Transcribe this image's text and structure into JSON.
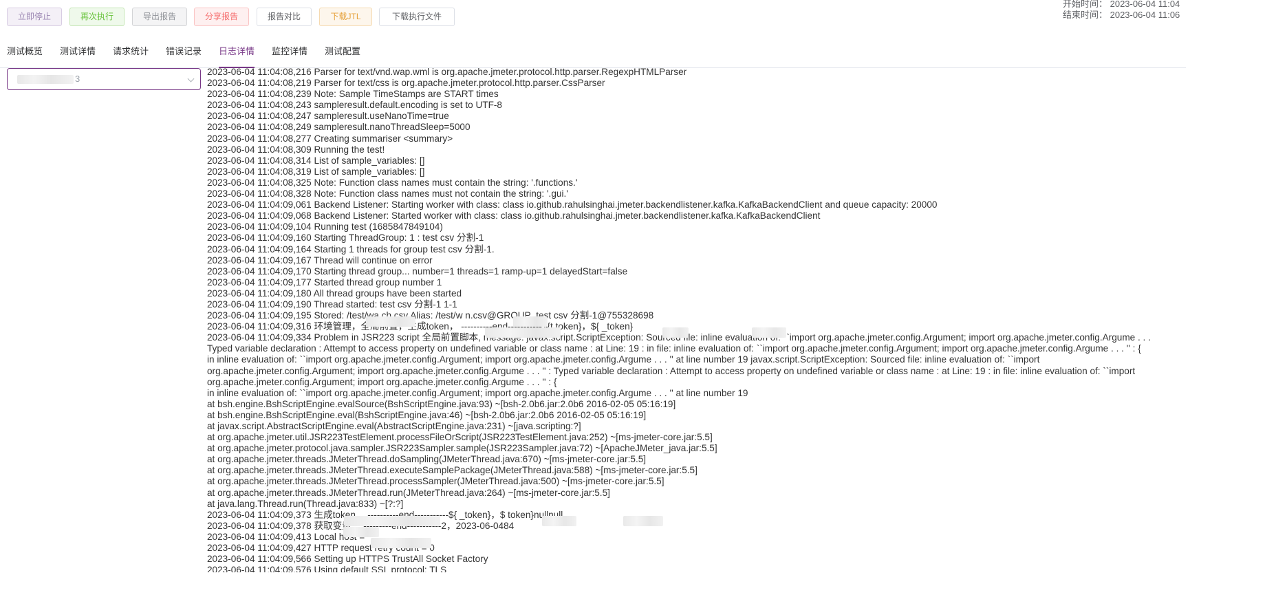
{
  "toolbar": {
    "stop": "立即停止",
    "rerun": "再次执行",
    "export": "导出报告",
    "share": "分享报告",
    "compare": "报告对比",
    "jtl": "下载JTL",
    "exec_file": "下载执行文件"
  },
  "times": {
    "start": "开始时间： 2023-06-04 11:04",
    "end": "结束时间： 2023-06-04 11:06"
  },
  "tabs": [
    "测试概览",
    "测试详情",
    "请求统计",
    "错误记录",
    "日志详情",
    "监控详情",
    "测试配置"
  ],
  "active_tab": "日志详情",
  "selector": {
    "value": "3"
  },
  "log_lines": [
    "2023-06-04 11:04:08,216 Parser for text/vnd.wap.wml is org.apache.jmeter.protocol.http.parser.RegexpHTMLParser",
    "2023-06-04 11:04:08,219 Parser for text/css is org.apache.jmeter.protocol.http.parser.CssParser",
    "2023-06-04 11:04:08,239 Note: Sample TimeStamps are START times",
    "2023-06-04 11:04:08,243 sampleresult.default.encoding is set to UTF-8",
    "2023-06-04 11:04:08,247 sampleresult.useNanoTime=true",
    "2023-06-04 11:04:08,249 sampleresult.nanoThreadSleep=5000",
    "2023-06-04 11:04:08,277 Creating summariser <summary>",
    "2023-06-04 11:04:08,309 Running the test!",
    "2023-06-04 11:04:08,314 List of sample_variables: []",
    "2023-06-04 11:04:08,319 List of sample_variables: []",
    "2023-06-04 11:04:08,325 Note: Function class names must contain the string: '.functions.'",
    "2023-06-04 11:04:08,328 Note: Function class names must not contain the string: '.gui.'",
    "2023-06-04 11:04:09,061 Backend Listener: Starting worker with class: class io.github.rahulsinghai.jmeter.backendlistener.kafka.KafkaBackendClient and queue capacity: 20000",
    "2023-06-04 11:04:09,068 Backend Listener: Started worker with class: class io.github.rahulsinghai.jmeter.backendlistener.kafka.KafkaBackendClient",
    "2023-06-04 11:04:09,104 Running test (1685847849104)",
    "2023-06-04 11:04:09,160 Starting ThreadGroup: 1 : test csv 分割-1",
    "2023-06-04 11:04:09,164 Starting 1 threads for group test csv 分割-1.",
    "2023-06-04 11:04:09,167 Thread will continue on error",
    "2023-06-04 11:04:09,170 Starting thread group... number=1 threads=1 ramp-up=1 delayedStart=false",
    "2023-06-04 11:04:09,177 Started thread group number 1",
    "2023-06-04 11:04:09,180 All thread groups have been started",
    "2023-06-04 11:04:09,190 Thread started: test csv 分割-1 1-1",
    "2023-06-04 11:04:09,195 Stored: /test/wa                ch.csv Alias: /test/w              n.csv@GROUP_test csv 分割-1@755328698",
    "2023-06-04 11:04:09,316 环境管理，全局前置，生成token，        ----------end-----------${t          token}，${              _token}",
    "2023-06-04 11:04:09,334 Problem in JSR223 script 全局前置脚本, message: javax.script.ScriptException: Sourced file: inline evaluation of: ``import org.apache.jmeter.config.Argument; import org.apache.jmeter.config.Argume . . .",
    "Typed variable declaration : Attempt to access property on undefined variable or class name : at Line: 19 : in file: inline evaluation of: ``import org.apache.jmeter.config.Argument; import org.apache.jmeter.config.Argume . . . '' : {",
    "in inline evaluation of: ``import org.apache.jmeter.config.Argument; import org.apache.jmeter.config.Argume . . . '' at line number 19 javax.script.ScriptException: Sourced file: inline evaluation of: ``import",
    "org.apache.jmeter.config.Argument; import org.apache.jmeter.config.Argume . . . '' : Typed variable declaration : Attempt to access property on undefined variable or class name : at Line: 19 : in file: inline evaluation of: ``import",
    "org.apache.jmeter.config.Argument; import org.apache.jmeter.config.Argume . . . '' : {",
    "in inline evaluation of: ``import org.apache.jmeter.config.Argument; import org.apache.jmeter.config.Argume . . . '' at line number 19",
    "at bsh.engine.BshScriptEngine.evalSource(BshScriptEngine.java:93) ~[bsh-2.0b6.jar:2.0b6 2016-02-05 05:16:19]",
    "at bsh.engine.BshScriptEngine.eval(BshScriptEngine.java:46) ~[bsh-2.0b6.jar:2.0b6 2016-02-05 05:16:19]",
    "at javax.script.AbstractScriptEngine.eval(AbstractScriptEngine.java:231) ~[java.scripting:?]",
    "at org.apache.jmeter.util.JSR223TestElement.processFileOrScript(JSR223TestElement.java:252) ~[ms-jmeter-core.jar:5.5]",
    "at org.apache.jmeter.protocol.java.sampler.JSR223Sampler.sample(JSR223Sampler.java:72) ~[ApacheJMeter_java.jar:5.5]",
    "at org.apache.jmeter.threads.JMeterThread.doSampling(JMeterThread.java:670) ~[ms-jmeter-core.jar:5.5]",
    "at org.apache.jmeter.threads.JMeterThread.executeSamplePackage(JMeterThread.java:588) ~[ms-jmeter-core.jar:5.5]",
    "at org.apache.jmeter.threads.JMeterThread.processSampler(JMeterThread.java:500) ~[ms-jmeter-core.jar:5.5]",
    "at org.apache.jmeter.threads.JMeterThread.run(JMeterThread.java:264) ~[ms-jmeter-core.jar:5.5]",
    "at java.lang.Thread.run(Thread.java:833) ~[?:?]",
    "2023-06-04 11:04:09,373 生成token，                                 ----------end-----------${              _token}，$              token}nullnull",
    "2023-06-04 11:04:09,378 获取变量，            ---------end-----------2，2023-06-0484",
    "2023-06-04 11:04:09,413 Local host =",
    "2023-06-04 11:04:09,427 HTTP request retry count = 0",
    "2023-06-04 11:04:09,566 Setting up HTTPS TrustAll Socket Factory",
    "2023-06-04 11:04:09,576 Using default SSL protocol: TLS"
  ]
}
